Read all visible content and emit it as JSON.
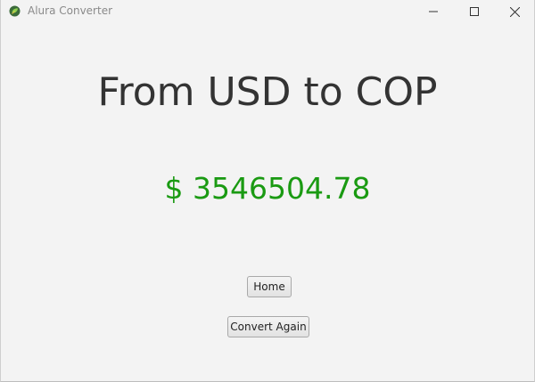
{
  "window": {
    "title": "Alura Converter",
    "minimize_icon": "minimize-icon",
    "maximize_icon": "maximize-icon",
    "close_icon": "close-icon"
  },
  "main": {
    "heading": "From USD to COP",
    "amount": "$ 3546504.78",
    "amount_color": "#1a9a12"
  },
  "buttons": {
    "home_label": "Home",
    "convert_again_label": "Convert Again"
  }
}
